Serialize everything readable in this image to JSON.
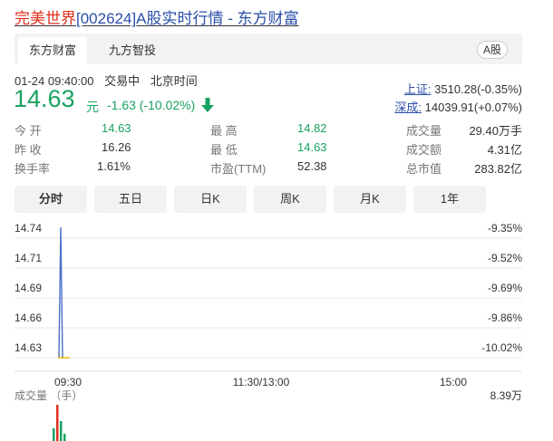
{
  "page_title": {
    "name": "完美世界",
    "code_suffix": "[002624]A股实时行情 - 东方财富"
  },
  "top_tabs": [
    {
      "label": "东方财富",
      "active": true
    },
    {
      "label": "九方智投",
      "active": false
    }
  ],
  "badge": "A股",
  "status": {
    "datetime": "01-24 09:40:00",
    "state": "交易中",
    "timezone": "北京时间"
  },
  "quote": {
    "price": "14.63",
    "unit": "元",
    "change": "-1.63 (-10.02%)"
  },
  "indices": [
    {
      "name": "上证:",
      "value": "3510.28(-0.35%)"
    },
    {
      "name": "深成:",
      "value": "14039.91(+0.07%)"
    }
  ],
  "stats": {
    "open": {
      "label": "今  开",
      "value": "14.63"
    },
    "prev_close": {
      "label": "昨  收",
      "value": "16.26"
    },
    "turnover": {
      "label": "换手率",
      "value": "1.61%"
    },
    "high": {
      "label": "最  高",
      "value": "14.82"
    },
    "low": {
      "label": "最  低",
      "value": "14.63"
    },
    "pe": {
      "label": "市盈(TTM)",
      "value": "52.38"
    },
    "volume": {
      "label": "成交量",
      "value": "29.40万手"
    },
    "amount": {
      "label": "成交额",
      "value": "4.31亿"
    },
    "market_cap": {
      "label": "总市值",
      "value": "283.82亿"
    }
  },
  "period_tabs": [
    {
      "label": "分时",
      "active": true
    },
    {
      "label": "五日",
      "active": false
    },
    {
      "label": "日K",
      "active": false
    },
    {
      "label": "周K",
      "active": false
    },
    {
      "label": "月K",
      "active": false
    },
    {
      "label": "1年",
      "active": false
    }
  ],
  "colors": {
    "up": "#e0301e",
    "down": "#1aa260",
    "link": "#2a4fa8",
    "price_line": "#4a6fc7",
    "avg_line": "#f0b400"
  },
  "chart_data": {
    "type": "line",
    "y_ticks": [
      "14.74",
      "14.71",
      "14.69",
      "14.66",
      "14.63"
    ],
    "pct_ticks": [
      "-9.35%",
      "-9.52%",
      "-9.69%",
      "-9.86%",
      "-10.02%"
    ],
    "x_ticks": [
      "09:30",
      "11:30/13:00",
      "15:00"
    ],
    "ylim": [
      14.63,
      14.74
    ],
    "series": [
      {
        "values": [
          14.63,
          14.75,
          14.63,
          14.63
        ]
      },
      {
        "values": [
          14.63,
          14.63,
          14.63,
          14.63
        ]
      }
    ],
    "volume_label": "成交量 （手）",
    "volume_max": "8.39万",
    "volume_values": [
      0.35,
      1.0,
      0.55,
      0.2
    ]
  }
}
